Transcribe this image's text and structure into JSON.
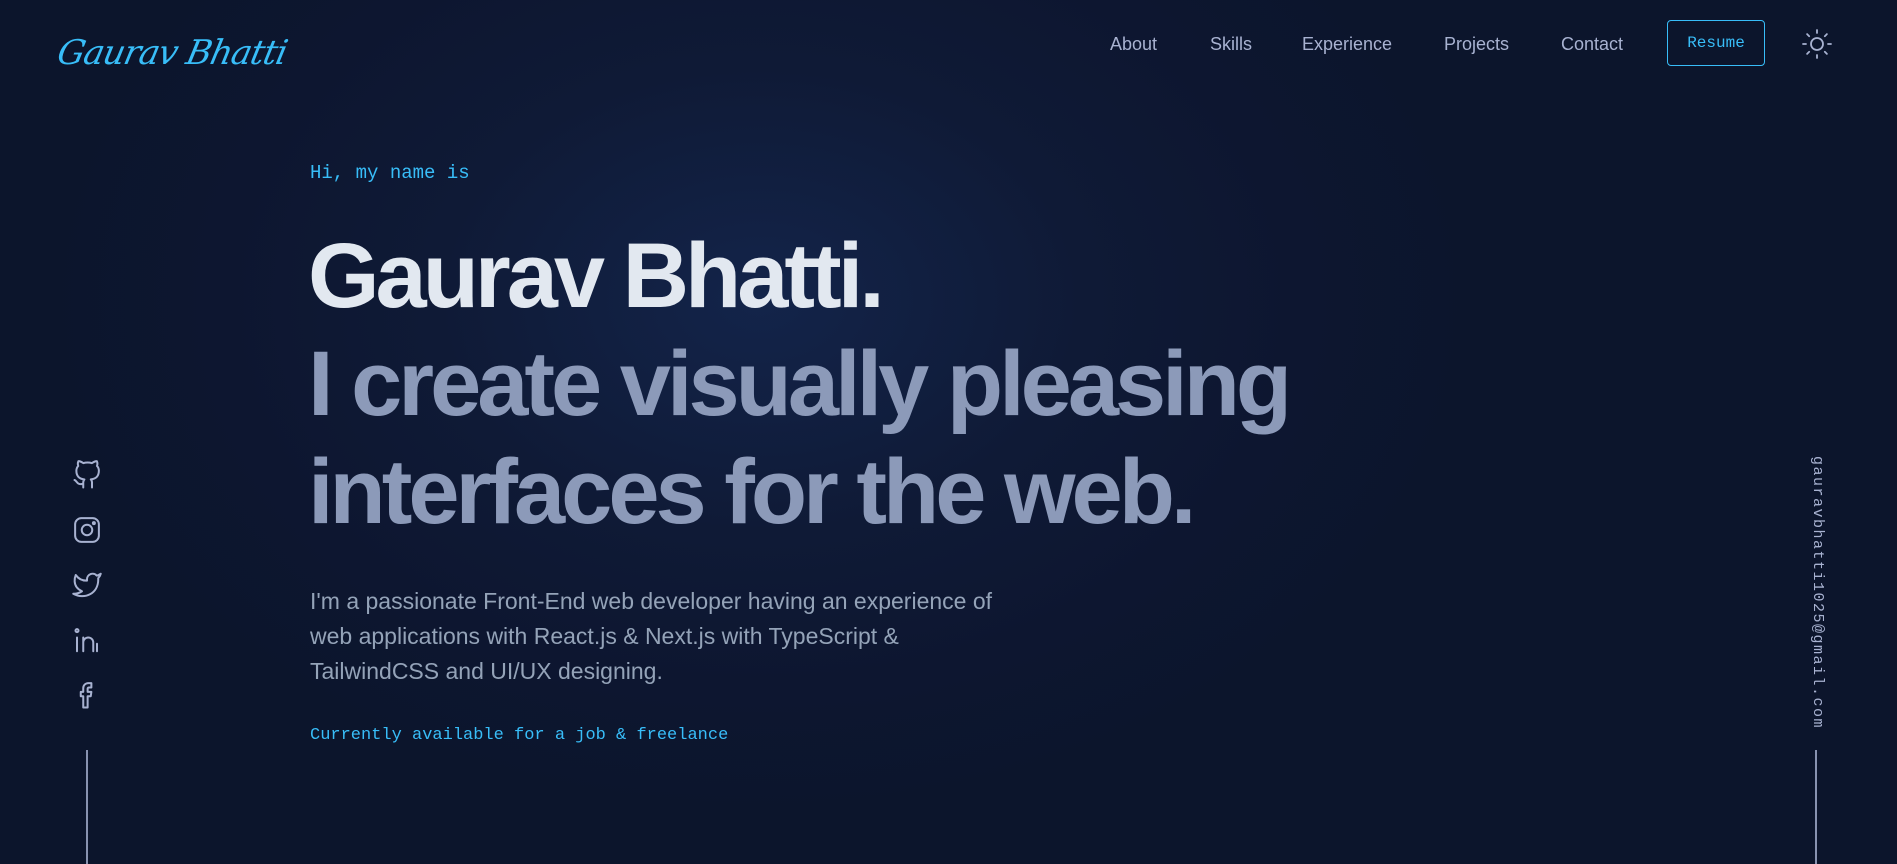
{
  "header": {
    "logo_text": "Gaurav Bhatti",
    "nav": [
      {
        "label": "About"
      },
      {
        "label": "Skills"
      },
      {
        "label": "Experience"
      },
      {
        "label": "Projects"
      },
      {
        "label": "Contact"
      }
    ],
    "resume_label": "Resume",
    "theme_toggle_icon": "sun-icon"
  },
  "hero": {
    "greeting": "Hi, my name is",
    "name": "Gaurav Bhatti.",
    "tagline": "I create visually pleasing interfaces for the web.",
    "description": "I'm a passionate Front-End web developer having an experience of web applications with React.js & Next.js with TypeScript & TailwindCSS and UI/UX designing.",
    "availability": "Currently available for a job & freelance"
  },
  "social": [
    "github-icon",
    "instagram-icon",
    "twitter-icon",
    "linkedin-icon",
    "facebook-icon"
  ],
  "email": "gauravbhatti1025@gmail.com",
  "colors": {
    "accent": "#38bdf8",
    "background": "#0f1a36",
    "name_text": "#e2e8f0",
    "tagline_text": "#8c9ab9",
    "body_text": "#94a3b8"
  }
}
